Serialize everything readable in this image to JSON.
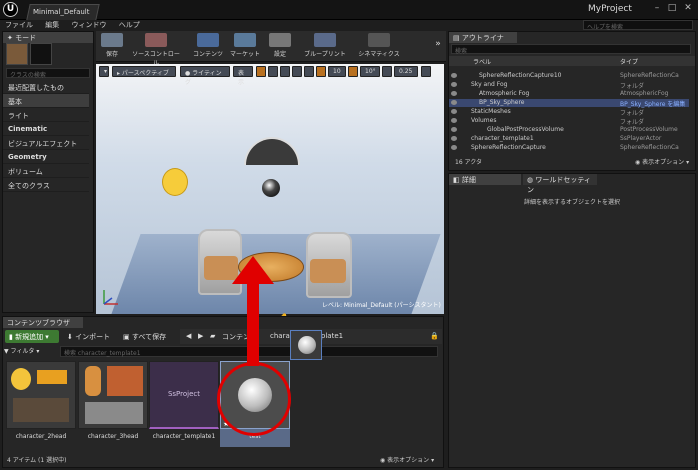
{
  "window": {
    "logo": "U",
    "doc_tab": "Minimal_Default",
    "project_name": "MyProject",
    "help_search_placeholder": "ヘルプを検索"
  },
  "menu": [
    "ファイル",
    "編集",
    "ウィンドウ",
    "ヘルプ"
  ],
  "modes_panel": {
    "tab": "モード",
    "search_placeholder": "クラスの検索",
    "categories": [
      {
        "label": "最近配置したもの",
        "bold": false
      },
      {
        "label": "基本",
        "bold": false
      },
      {
        "label": "ライト",
        "bold": false
      },
      {
        "label": "Cinematic",
        "bold": true
      },
      {
        "label": "ビジュアルエフェクト",
        "bold": false
      },
      {
        "label": "Geometry",
        "bold": true
      },
      {
        "label": "ボリューム",
        "bold": false
      },
      {
        "label": "全てのクラス",
        "bold": false
      }
    ]
  },
  "toolbar": {
    "save": "保存",
    "source_control": "ソースコントロール",
    "content": "コンテンツ",
    "market": "マーケット",
    "settings": "設定",
    "blueprint": "ブループリント",
    "cinematics": "シネマティクス"
  },
  "viewport": {
    "perspective": "パースペクティブ",
    "lighting": "ライティング",
    "show": "表示",
    "grid_snap": "10",
    "rot_snap": "10°",
    "scale_snap": "0.25",
    "level_label": "レベル: Minimal_Default (パーシスタント)"
  },
  "content_browser": {
    "tab": "コンテンツブラウザ",
    "add_new": "新規追加",
    "import": "インポート",
    "save_all": "すべて保存",
    "path_root": "コンテンツ",
    "path_child": "character_template1",
    "filter": "フィルタ",
    "search_placeholder": "検索 character_template1",
    "assets": [
      {
        "label": "character_2head"
      },
      {
        "label": "character_3head"
      },
      {
        "label": "character_template1",
        "thumb_text": "SsProject"
      },
      {
        "label": "test"
      }
    ],
    "status": "4 アイテム (1 選択中)",
    "view_options": "表示オプション"
  },
  "outliner": {
    "tab": "アウトライナ",
    "search_placeholder": "検索",
    "col_label": "ラベル",
    "col_type": "タイプ",
    "rows": [
      {
        "label": "SphereReflectionCapture10",
        "type": "SphereReflectionCa",
        "selected": false
      },
      {
        "label": "Sky and Fog",
        "type": "フォルダ",
        "selected": false
      },
      {
        "label": "Atmospheric Fog",
        "type": "AtmosphericFog",
        "selected": false
      },
      {
        "label": "BP_Sky_Sphere",
        "type": "BP_Sky_Sphere を編集",
        "selected": true
      },
      {
        "label": "StaticMeshes",
        "type": "フォルダ",
        "selected": false
      },
      {
        "label": "Volumes",
        "type": "フォルダ",
        "selected": false
      },
      {
        "label": "GlobalPostProcessVolume",
        "type": "PostProcessVolume",
        "selected": false
      },
      {
        "label": "character_template1",
        "type": "SsPlayerActor",
        "selected": false
      },
      {
        "label": "SphereReflectionCapture",
        "type": "SphereReflectionCa",
        "selected": false
      }
    ],
    "count": "16 アクタ",
    "view_options": "表示オプション"
  },
  "details": {
    "tab": "詳細",
    "world_tab": "ワールドセッティン",
    "empty_message": "詳細を表示するオブジェクトを選択"
  },
  "colors": {
    "highlight": "#e00000",
    "add_button": "#3d7a32",
    "selection": "#3a4870"
  }
}
